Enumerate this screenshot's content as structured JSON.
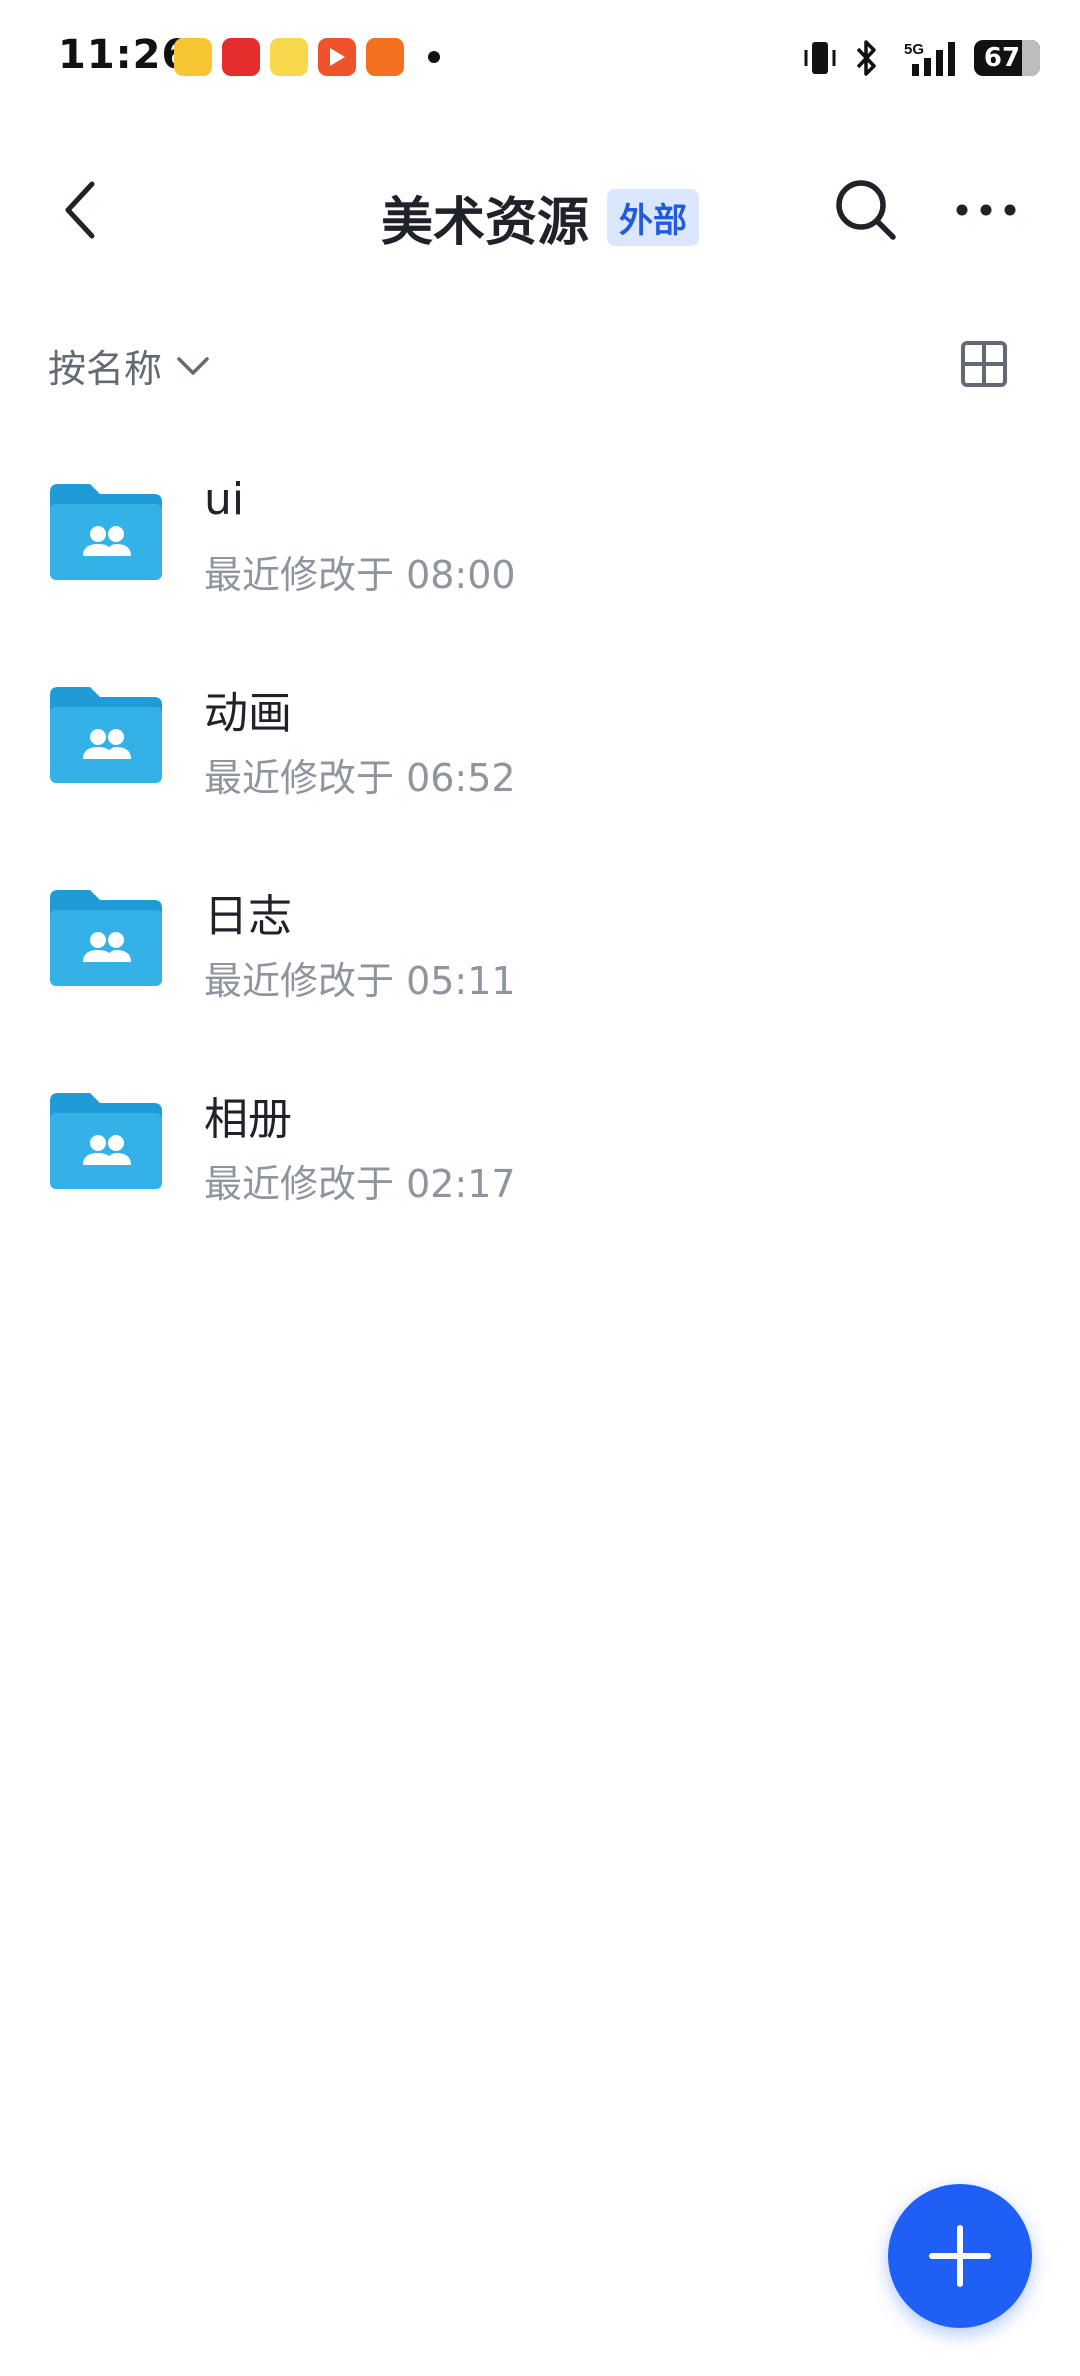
{
  "status_bar": {
    "time": "11:26",
    "battery": "67",
    "network": "5G"
  },
  "header": {
    "title": "美术资源",
    "badge": "外部"
  },
  "sort": {
    "label": "按名称"
  },
  "folders": [
    {
      "name": "ui",
      "meta": "最近修改于 08:00"
    },
    {
      "name": "动画",
      "meta": "最近修改于 06:52"
    },
    {
      "name": "日志",
      "meta": "最近修改于 05:11"
    },
    {
      "name": "相册",
      "meta": "最近修改于 02:17"
    }
  ],
  "icons": {
    "back": "back-arrow-icon",
    "search": "search-icon",
    "more": "more-icon",
    "sort_chevron": "chevron-down-icon",
    "grid_view": "grid-view-icon",
    "folder": "shared-folder-icon",
    "add": "plus-icon"
  },
  "colors": {
    "accent": "#1f5ff5",
    "badge_bg": "#dbe7ff",
    "badge_text": "#245bdb",
    "folder_back": "#1f9bd8",
    "folder_front": "#34b2e8",
    "secondary_text": "#8f959e"
  }
}
